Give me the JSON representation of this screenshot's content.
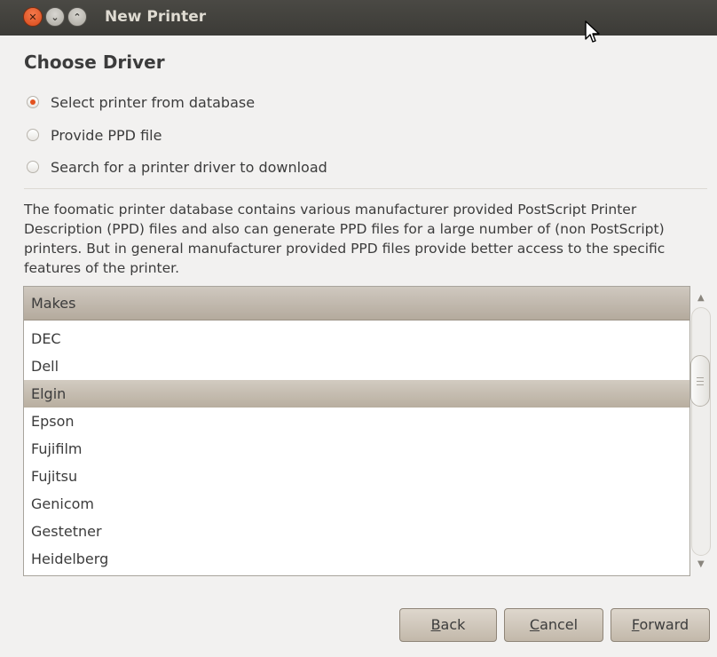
{
  "window": {
    "title": "New Printer",
    "controls": [
      "close-icon",
      "minimize-icon",
      "maximize-icon"
    ]
  },
  "page": {
    "heading": "Choose Driver"
  },
  "options": [
    {
      "label": "Select printer from database",
      "checked": true
    },
    {
      "label": "Provide PPD file",
      "checked": false
    },
    {
      "label": "Search for a printer driver to download",
      "checked": false
    }
  ],
  "description": "The foomatic printer database contains various manufacturer provided PostScript Printer Description (PPD) files and also can generate PPD files for a large number of (non PostScript) printers. But in general manufacturer provided PPD files provide better access to the specific features of the printer.",
  "makes": {
    "column_header": "Makes",
    "items": [
      "DEC",
      "Dell",
      "Elgin",
      "Epson",
      "Fujifilm",
      "Fujitsu",
      "Genicom",
      "Gestetner",
      "Heidelberg"
    ],
    "selected": "Elgin"
  },
  "buttons": {
    "back": {
      "mnemonic": "B",
      "rest": "ack"
    },
    "cancel": {
      "mnemonic": "C",
      "rest": "ancel"
    },
    "forward": {
      "mnemonic": "F",
      "rest": "orward"
    }
  },
  "colors": {
    "accent": "#e3521f",
    "titlebar": "#3c3b37",
    "selection": "#b8ae9f"
  }
}
